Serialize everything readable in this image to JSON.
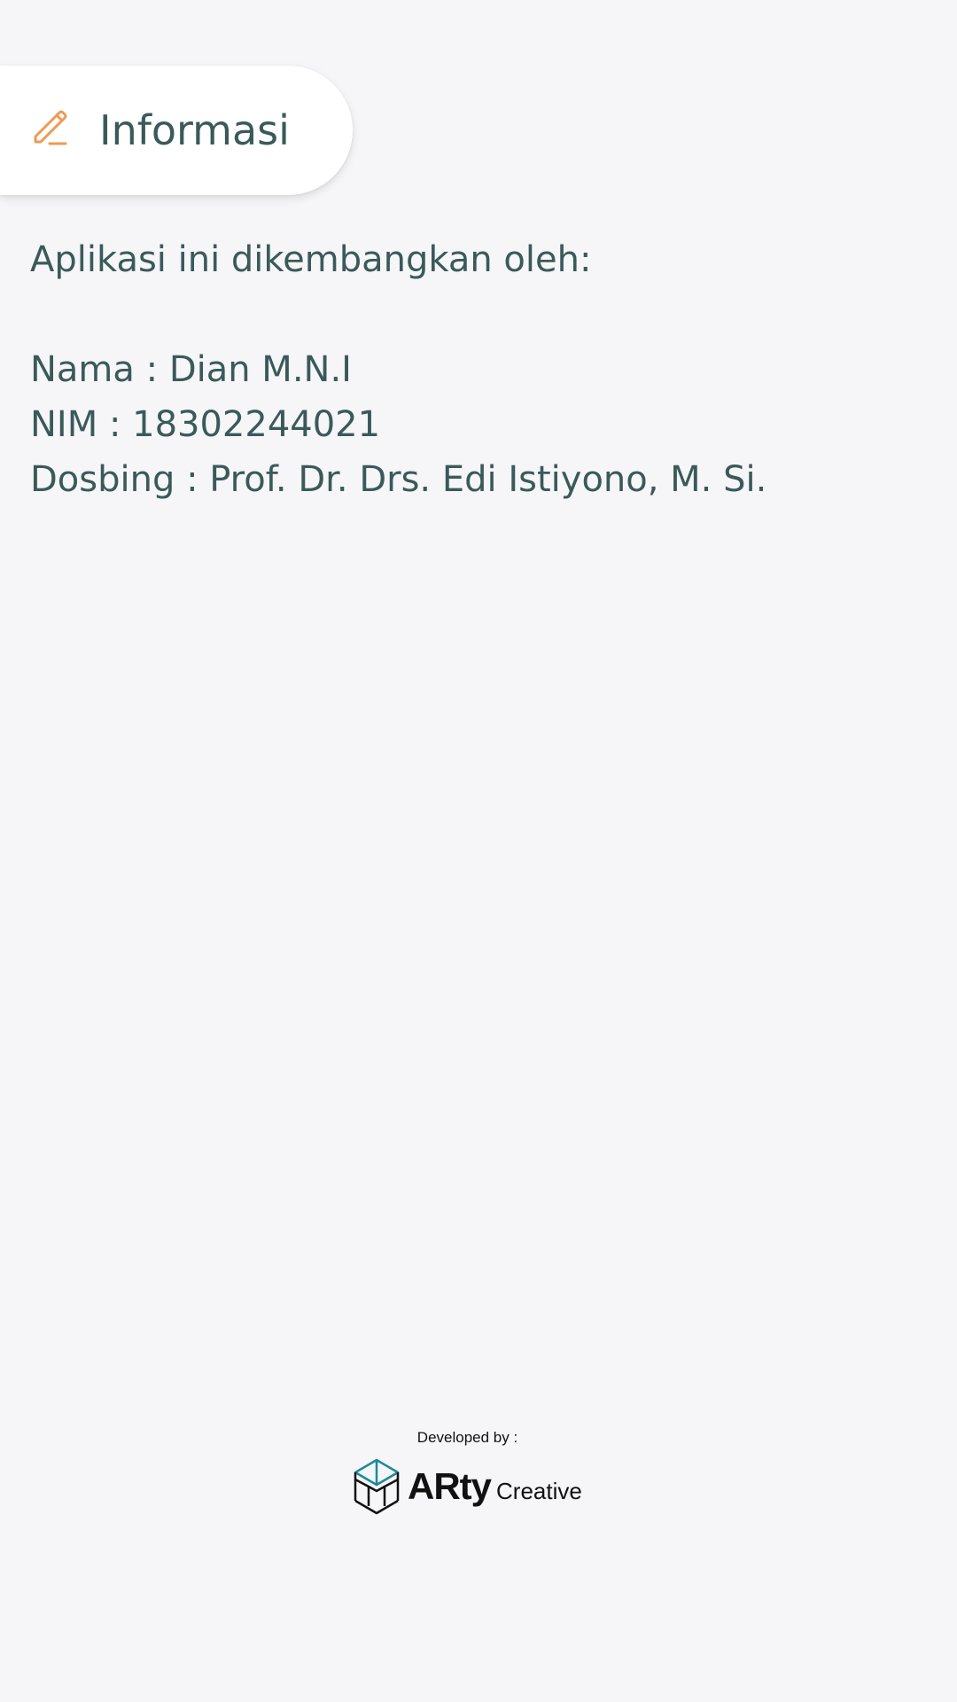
{
  "header": {
    "title": "Informasi",
    "icon": "pencil-icon",
    "icon_color": "#ef9a52"
  },
  "info": {
    "intro": "Aplikasi ini dikembangkan oleh:",
    "name_line": "Nama : Dian M.N.I",
    "nim_line": "NIM : 18302244021",
    "advisor_line": "Dosbing : Prof. Dr. Drs. Edi Istiyono, M. Si."
  },
  "footer": {
    "developed_by": "Developed by :",
    "brand_main": "ARty",
    "brand_sub": "Creative",
    "logo_icon": "cube-logo-icon",
    "logo_accent_color": "#1a8a9a"
  },
  "colors": {
    "background": "#f6f5f8",
    "text": "#3a5a5a"
  }
}
